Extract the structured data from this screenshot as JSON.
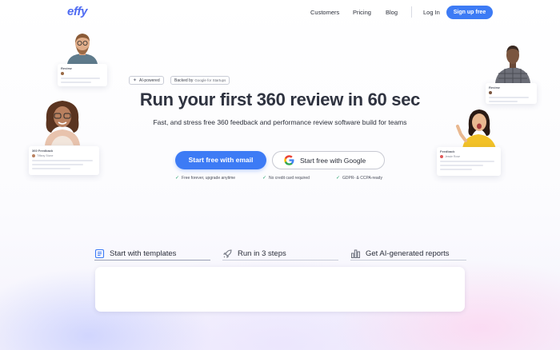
{
  "nav": {
    "logo": "effy",
    "links": [
      "Customers",
      "Pricing",
      "Blog"
    ],
    "login": "Log In",
    "signup": "Sign up free"
  },
  "hero": {
    "badge_ai": "AI-powered",
    "badge_backed_prefix": "Backed by",
    "badge_backed_name": "Google for Startups",
    "title": "Run your first 360 review in 60 sec",
    "subtitle": "Fast, and stress free 360 feedback and performance review software build for teams",
    "cta_email": "Start free with email",
    "cta_google": "Start free with Google",
    "checks": [
      "Free forever, upgrade anytime",
      "No credit card required",
      "GDPR- & CCPA-ready"
    ]
  },
  "cards": {
    "left_top_title": "Review",
    "left_bottom_title": "360 Feedback",
    "left_bottom_name": "Tiffany Stone",
    "right_top_title": "Review",
    "right_bottom_title": "Feedback",
    "right_bottom_name": "Jessie Rose"
  },
  "features": {
    "tabs": [
      "Start with templates",
      "Run in 3 steps",
      "Get AI-generated reports"
    ],
    "active_index": 0
  },
  "colors": {
    "brand": "#4f6bf2",
    "primary_button": "#3d7bf5",
    "check": "#22a06b"
  },
  "icons": {
    "tab_icons": [
      "document-icon",
      "rocket-icon",
      "bar-chart-icon"
    ],
    "google": "google-g-icon",
    "sparkle": "sparkle-icon"
  }
}
